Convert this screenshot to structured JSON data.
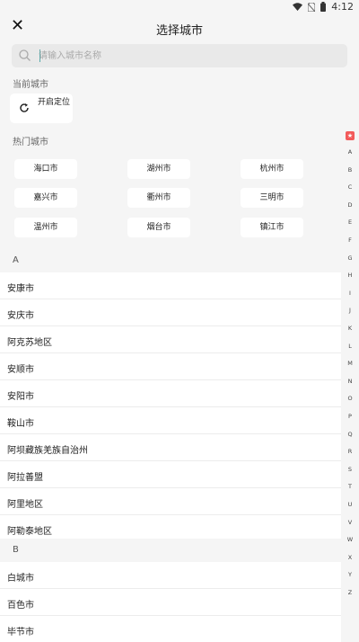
{
  "status": {
    "time": "4:12"
  },
  "header": {
    "title": "选择城市"
  },
  "search": {
    "placeholder": "请输入城市名称"
  },
  "current": {
    "label": "当前城市",
    "locate_label": "开启定位"
  },
  "hot": {
    "label": "热门城市",
    "cities": [
      "海口市",
      "湖州市",
      "杭州市",
      "嘉兴市",
      "衢州市",
      "三明市",
      "温州市",
      "烟台市",
      "镇江市"
    ]
  },
  "groups": [
    {
      "letter": "A",
      "cities": [
        "安康市",
        "安庆市",
        "阿克苏地区",
        "安顺市",
        "安阳市",
        "鞍山市",
        "阿坝藏族羌族自治州",
        "阿拉善盟",
        "阿里地区",
        "阿勒泰地区"
      ]
    },
    {
      "letter": "B",
      "cities": [
        "白城市",
        "百色市",
        "毕节市"
      ]
    }
  ],
  "index_letters": [
    "A",
    "B",
    "C",
    "D",
    "E",
    "F",
    "G",
    "H",
    "I",
    "J",
    "K",
    "L",
    "M",
    "N",
    "O",
    "P",
    "Q",
    "R",
    "S",
    "T",
    "U",
    "V",
    "W",
    "X",
    "Y",
    "Z"
  ],
  "colors": {
    "background": "#f5f5f5",
    "index_accent": "#f25a5a"
  }
}
